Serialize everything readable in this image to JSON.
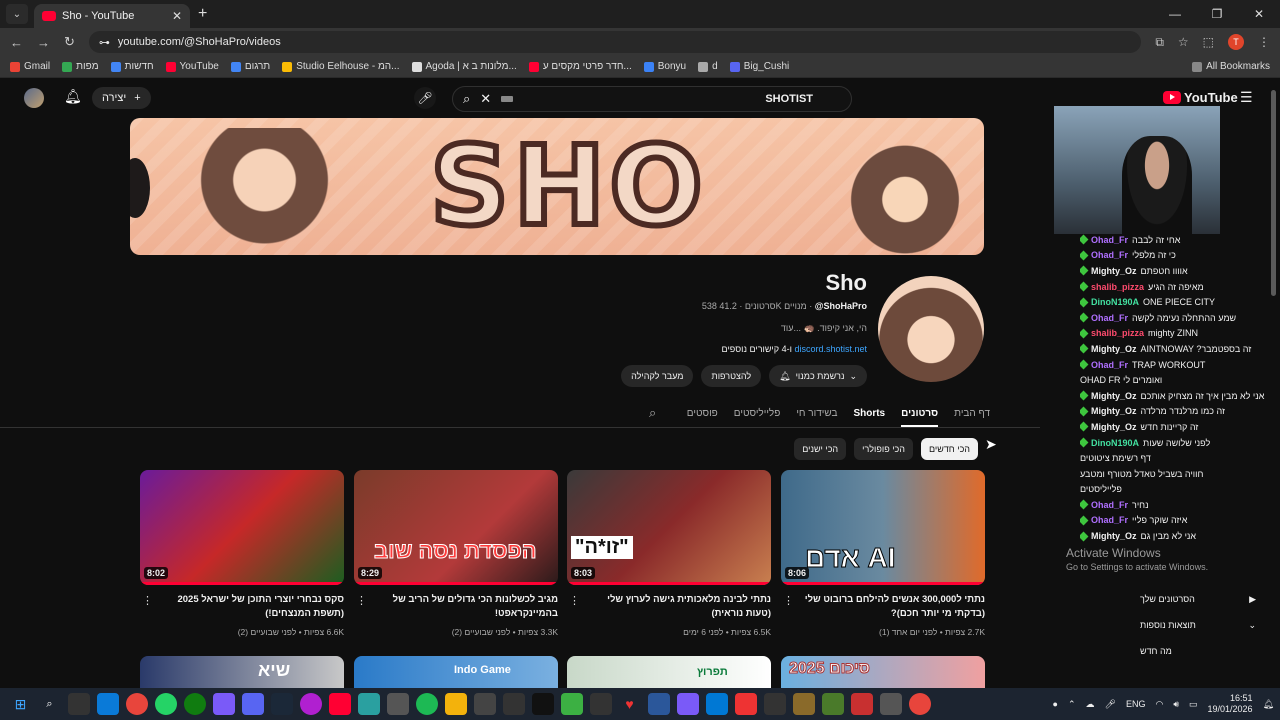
{
  "browser": {
    "tab_title": "Sho - YouTube",
    "new_tab": "+",
    "url": "youtube.com/@ShoHaPro/videos",
    "bookmarks": [
      "Gmail",
      "מפות",
      "חדשות",
      "YouTube",
      "תרגום",
      "Studio Eelhouse - המ...",
      "Agoda | מלונות ב א...",
      "חדר פרטי מקסים ע...",
      "Bonyu",
      "d",
      "Big_Cushi"
    ],
    "all_bookmarks": "All Bookmarks",
    "profile_letter": "T"
  },
  "yt": {
    "create_label": "יצירה",
    "search_query": "SHOTIST",
    "logo_text": "YouTube",
    "channel": {
      "name": "Sho",
      "handle": "@ShoHaPro",
      "subs": "41.2K מנויים",
      "videos": "538 סרטונים",
      "description": "הי, אני קיפוד. 🦔 ...עוד",
      "link": "discord.shotist.net",
      "more_links": "ו-4 קישורים נוספים",
      "btn_subscribed": "נרשמת כמנוי",
      "btn_join": "להצטרפות",
      "btn_community": "מעבר לקהילה"
    },
    "tabs": [
      "דף הבית",
      "סרטונים",
      "Shorts",
      "בשידור חי",
      "פלייליסטים",
      "פוסטים"
    ],
    "chips": [
      "הכי חדשים",
      "הכי פופולרי",
      "הכי ישנים"
    ],
    "videos": [
      {
        "title": "סקס נבחרי יוצרי התוכן של ישראל 2025 (תשפת המנצחים!)",
        "meta": "6.6K צפיות • לפני שבועיים (2)",
        "duration": "8:02"
      },
      {
        "title": "מגיב לכשלונות הכי גדולים של הריב של בהמיינקראפט!",
        "meta": "3.3K צפיות • לפני שבועיים (2)",
        "duration": "8:29"
      },
      {
        "title": "נתתי לבינה מלאכותית גישה לערוץ שלי (טעות נוראית)",
        "meta": "6.5K צפיות • לפני 6 ימים",
        "duration": "8:03"
      },
      {
        "title": "נתתי ל300,000 אנשים להילחם ברובוט שלי (בדקתי מי יותר חכם)?",
        "meta": "2.7K צפיות • לפני יום אחד (1)",
        "duration": "8:06"
      }
    ],
    "thumb_text": [
      "",
      "הפסדת נסה שוב",
      "\"זו*ה\"",
      "אדם AI"
    ],
    "row2_text": [
      "שיא",
      "Indo Game",
      "תפרוץ",
      "סיכום 2025"
    ]
  },
  "chat": [
    {
      "user": "Ohad_Fr",
      "msg": "אחי זה לבבה",
      "color": "#b070ff"
    },
    {
      "user": "Ohad_Fr",
      "msg": "כי זה מלפלי",
      "color": "#b070ff"
    },
    {
      "user": "Mighty_Oz",
      "msg": "אוווו חטפתם",
      "color": "#f1f1f1"
    },
    {
      "user": "shalib_pizza",
      "msg": "מאיפה זה הגיע",
      "color": "#ff4b6e"
    },
    {
      "user": "DinoN190A",
      "msg": "ONE PIECE CITY",
      "color": "#43e0a0"
    },
    {
      "user": "Ohad_Fr",
      "msg": "שמע ההתחלה נעימה לקשה",
      "color": "#b070ff"
    },
    {
      "user": "shalib_pizza",
      "msg": "mighty ZINN",
      "color": "#ff4b6e"
    },
    {
      "user": "Mighty_Oz",
      "msg": "AINTNOWAY ?זה בספטמבר",
      "color": "#f1f1f1"
    },
    {
      "user": "Ohad_Fr",
      "msg": "TRAP WORKOUT",
      "color": "#b070ff"
    },
    {
      "user": "",
      "msg": "OHAD FR ואומרים לי",
      "color": "#f1f1f1"
    },
    {
      "user": "Mighty_Oz",
      "msg": "אני לא מבין איך זה מצחיק אותכם",
      "color": "#f1f1f1"
    },
    {
      "user": "Mighty_Oz",
      "msg": "זה כמו מרלנדר מרלדה",
      "color": "#f1f1f1"
    },
    {
      "user": "Mighty_Oz",
      "msg": "זה קריינות חדש",
      "color": "#f1f1f1"
    },
    {
      "user": "DinoN190A",
      "msg": "לפני שלושה שעות",
      "color": "#43e0a0"
    },
    {
      "user": "",
      "msg": "דף רשימת ציטוטים",
      "color": "#f1f1f1"
    },
    {
      "user": "",
      "msg": "חוויה בשביל טאדל מטורף ומטבע",
      "color": "#f1f1f1"
    },
    {
      "user": "",
      "msg": "פלייליסטים",
      "color": "#f1f1f1"
    },
    {
      "user": "Ohad_Fr",
      "msg": "נחיר",
      "color": "#b070ff"
    },
    {
      "user": "Ohad_Fr",
      "msg": "איזה שוקר פליי",
      "color": "#b070ff"
    },
    {
      "user": "Mighty_Oz",
      "msg": "אני לא מבין גם",
      "color": "#f1f1f1"
    }
  ],
  "side_menu": [
    "הסרטונים שלך",
    "תוצאות נוספות",
    "מה חדש"
  ],
  "activate": {
    "title": "Activate Windows",
    "sub": "Go to Settings to activate Windows."
  },
  "taskbar": {
    "lang": "ENG",
    "time": "16:51",
    "date": "19/01/2026"
  }
}
